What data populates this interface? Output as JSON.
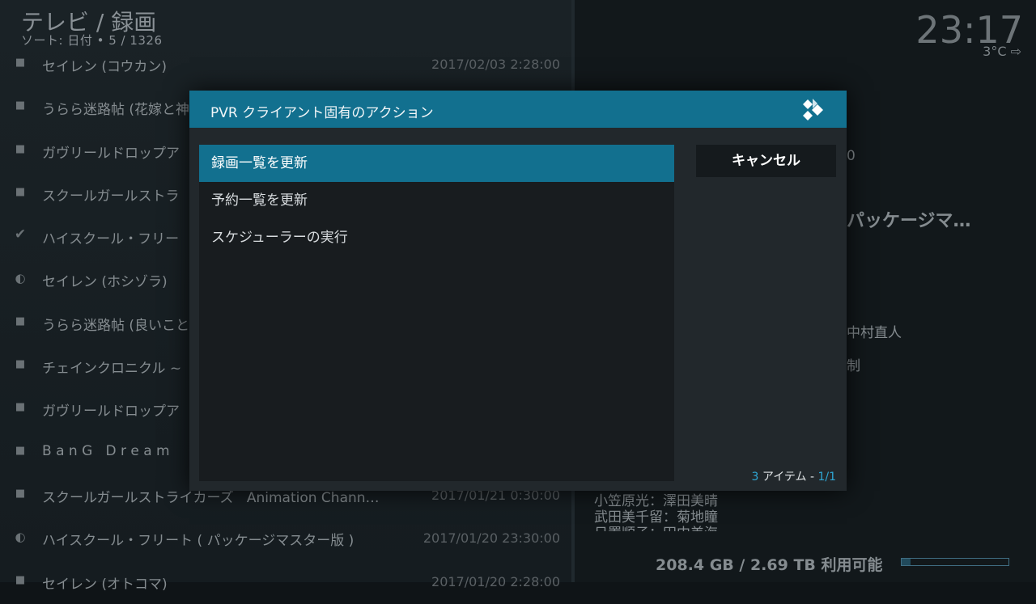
{
  "header": {
    "title": "テレビ / 録画",
    "sort_info": "ソート: 日付  •  5 / 1326",
    "clock": "23:17",
    "weather": "3°C ⇨"
  },
  "recordings": [
    {
      "icon": "bullet",
      "title": "セイレン (コウカン)",
      "date": "2017/02/03 2:28:00"
    },
    {
      "icon": "bullet",
      "title": "うらら迷路帖 (花嫁と神",
      "date": ""
    },
    {
      "icon": "bullet",
      "title": "ガヴリールドロップア",
      "date": ""
    },
    {
      "icon": "bullet",
      "title": "スクールガールストラ",
      "date": ""
    },
    {
      "icon": "check",
      "title": "ハイスクール・フリー",
      "date": ""
    },
    {
      "icon": "half",
      "title": "セイレン (ホシゾラ)",
      "date": ""
    },
    {
      "icon": "bullet",
      "title": "うらら迷路帖 (良いこと",
      "date": ""
    },
    {
      "icon": "bullet",
      "title": "チェインクロニクル ~",
      "date": ""
    },
    {
      "icon": "bullet",
      "title": "ガヴリールドロップア",
      "date": ""
    },
    {
      "icon": "bullet",
      "title": "B a n G   D r e a m",
      "date": ""
    },
    {
      "icon": "bullet",
      "title": "スクールガールストライカーズ   Animation Chann…",
      "date": "2017/01/21 0:30:00"
    },
    {
      "icon": "half",
      "title": "ハイスクール・フリート ( パッケージマスター版 )",
      "date": "2017/01/20 23:30:00"
    },
    {
      "icon": "bullet",
      "title": "セイレン (オトコマ)",
      "date": "2017/01/20 2:28:00"
    }
  ],
  "info_panel": {
    "fragment_0": "0",
    "title_fragment": "パッケージマ…",
    "credit_1": "中村直人",
    "credit_2": "制",
    "cast_1": "小笠原光：澤田美晴",
    "cast_2": "武田美千留：菊地瞳",
    "cast_3": "日置順子：田中美海"
  },
  "storage": {
    "text": "208.4 GB / 2.69 TB 利用可能",
    "used_fraction": 0.08
  },
  "dialog": {
    "title": "PVR クライアント固有のアクション",
    "items": [
      {
        "label": "録画一覧を更新"
      },
      {
        "label": "予約一覧を更新"
      },
      {
        "label": "スケジューラーの実行"
      }
    ],
    "cancel_label": "キャンセル",
    "count_number": "3",
    "count_text": " アイテム - ",
    "count_page": "1/1"
  },
  "colors": {
    "accent": "#12708f",
    "highlight_text": "#2fa8d6"
  },
  "icons": {
    "logo": "kodi-logo-icon",
    "bullet": "bullet-icon",
    "check": "check-icon",
    "half": "half-circle-icon"
  }
}
